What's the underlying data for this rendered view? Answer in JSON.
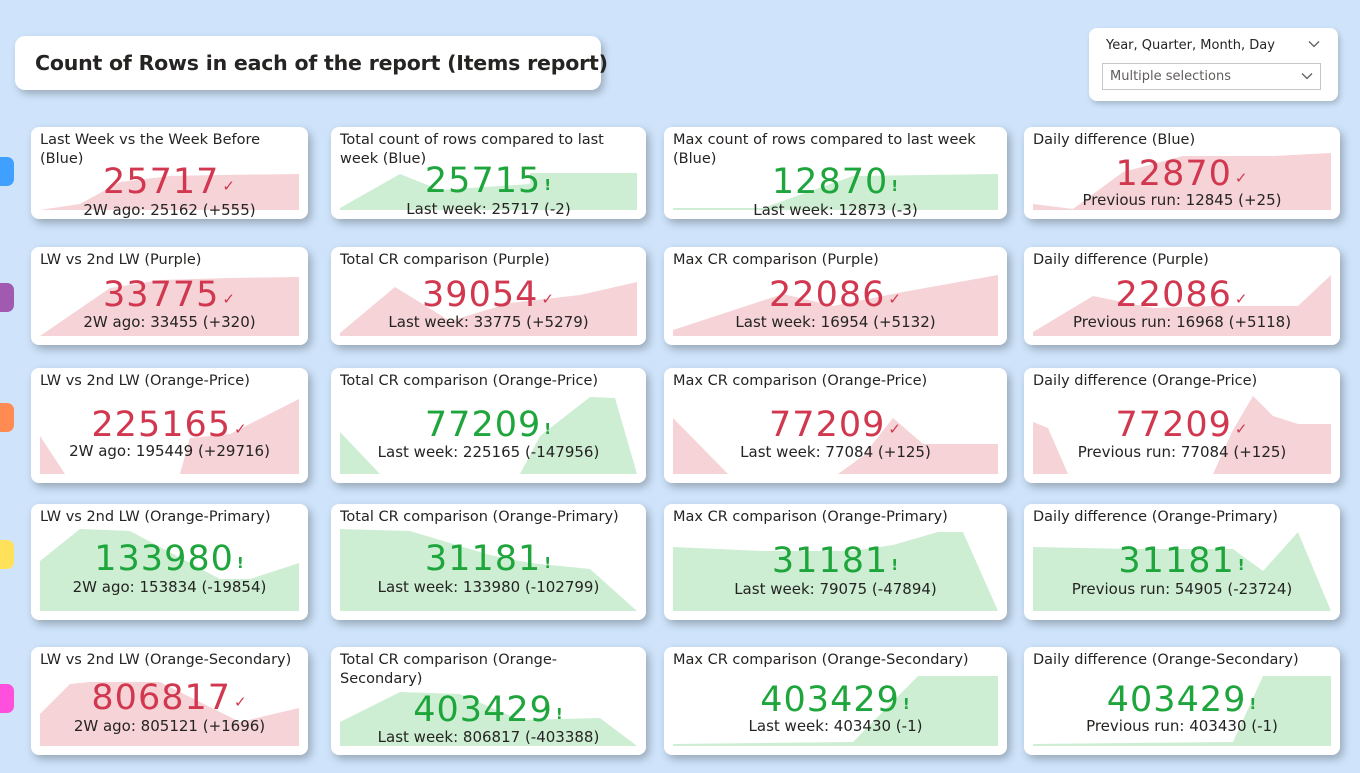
{
  "page_title": "Count of Rows in each of the report (Items report)",
  "slicer": {
    "header": "Year, Quarter, Month, Day",
    "selection": "Multiple selections",
    "header_icon": "chevron-down-icon",
    "selection_icon": "chevron-down-icon"
  },
  "colors": {
    "background": "#cfe4fb",
    "red_value": "#d1384f",
    "green_value": "#1ea53c",
    "red_area": "#f5d3d7",
    "green_area": "#cdeed3",
    "row_markers": [
      "#3fa0ff",
      "#a15aaf",
      "#ff8a52",
      "#ffe15a",
      "#ff4fdd"
    ]
  },
  "rows": [
    {
      "cards": [
        {
          "title": "Last Week vs the Week Before (Blue)",
          "value": "25717",
          "status": "red",
          "marker": "✓",
          "subtitle": "2W ago: 25162 (+555)"
        },
        {
          "title": "Total count of rows compared to last week (Blue)",
          "value": "25715",
          "status": "green",
          "marker": "!",
          "subtitle": "Last week: 25717 (-2)"
        },
        {
          "title": "Max count of rows compared to last week (Blue)",
          "value": "12870",
          "status": "green",
          "marker": "!",
          "subtitle": "Last week: 12873 (-3)"
        },
        {
          "title": "Daily difference (Blue)",
          "value": "12870",
          "status": "red",
          "marker": "✓",
          "subtitle": "Previous run: 12845 (+25)"
        }
      ]
    },
    {
      "cards": [
        {
          "title": "LW vs 2nd LW (Purple)",
          "value": "33775",
          "status": "red",
          "marker": "✓",
          "subtitle": "2W ago: 33455 (+320)"
        },
        {
          "title": "Total CR comparison (Purple)",
          "value": "39054",
          "status": "red",
          "marker": "✓",
          "subtitle": "Last week: 33775 (+5279)"
        },
        {
          "title": "Max CR comparison (Purple)",
          "value": "22086",
          "status": "red",
          "marker": "✓",
          "subtitle": "Last week: 16954 (+5132)"
        },
        {
          "title": "Daily difference (Purple)",
          "value": "22086",
          "status": "red",
          "marker": "✓",
          "subtitle": "Previous run: 16968 (+5118)"
        }
      ]
    },
    {
      "cards": [
        {
          "title": "LW vs 2nd LW (Orange-Price)",
          "value": "225165",
          "status": "red",
          "marker": "✓",
          "subtitle": "2W ago: 195449 (+29716)"
        },
        {
          "title": "Total CR comparison (Orange-Price)",
          "value": "77209",
          "status": "green",
          "marker": "!",
          "subtitle": "Last week: 225165 (-147956)"
        },
        {
          "title": "Max CR comparison (Orange-Price)",
          "value": "77209",
          "status": "red",
          "marker": "✓",
          "subtitle": "Last week: 77084 (+125)"
        },
        {
          "title": "Daily difference (Orange-Price)",
          "value": "77209",
          "status": "red",
          "marker": "✓",
          "subtitle": "Previous run: 77084 (+125)"
        }
      ]
    },
    {
      "cards": [
        {
          "title": "LW vs 2nd LW (Orange-Primary)",
          "value": "133980",
          "status": "green",
          "marker": "!",
          "subtitle": "2W ago: 153834 (-19854)"
        },
        {
          "title": "Total CR comparison (Orange-Primary)",
          "value": "31181",
          "status": "green",
          "marker": "!",
          "subtitle": "Last week: 133980 (-102799)"
        },
        {
          "title": "Max CR comparison (Orange-Primary)",
          "value": "31181",
          "status": "green",
          "marker": "!",
          "subtitle": "Last week: 79075 (-47894)"
        },
        {
          "title": "Daily difference (Orange-Primary)",
          "value": "31181",
          "status": "green",
          "marker": "!",
          "subtitle": "Previous run: 54905 (-23724)"
        }
      ]
    },
    {
      "cards": [
        {
          "title": "LW vs 2nd LW (Orange-Secondary)",
          "value": "806817",
          "status": "red",
          "marker": "✓",
          "subtitle": "2W ago: 805121 (+1696)"
        },
        {
          "title": "Total CR comparison (Orange-Secondary)",
          "value": "403429",
          "status": "green",
          "marker": "!",
          "subtitle": "Last week: 806817 (-403388)"
        },
        {
          "title": "Max CR comparison (Orange-Secondary)",
          "value": "403429",
          "status": "green",
          "marker": "!",
          "subtitle": "Last week: 403430 (-1)"
        },
        {
          "title": "Daily difference (Orange-Secondary)",
          "value": "403429",
          "status": "green",
          "marker": "!",
          "subtitle": "Previous run: 403430 (-1)"
        }
      ]
    }
  ]
}
